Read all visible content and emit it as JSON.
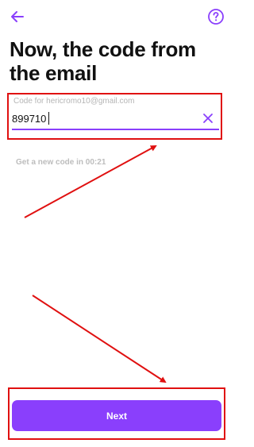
{
  "header": {
    "back_icon": "arrow-left-icon",
    "help_icon": "question-circle-icon"
  },
  "title": "Now, the code from the email",
  "code_field": {
    "label": "Code for hericromo10@gmail.com",
    "value": "899710",
    "clear_icon": "close-icon"
  },
  "resend_text": "Get a new code in 00:21",
  "next_button": {
    "label": "Next"
  },
  "colors": {
    "accent": "#8a3ffc",
    "annotation": "#e01010",
    "title_text": "#111111",
    "muted_text": "#bdbdbd"
  }
}
